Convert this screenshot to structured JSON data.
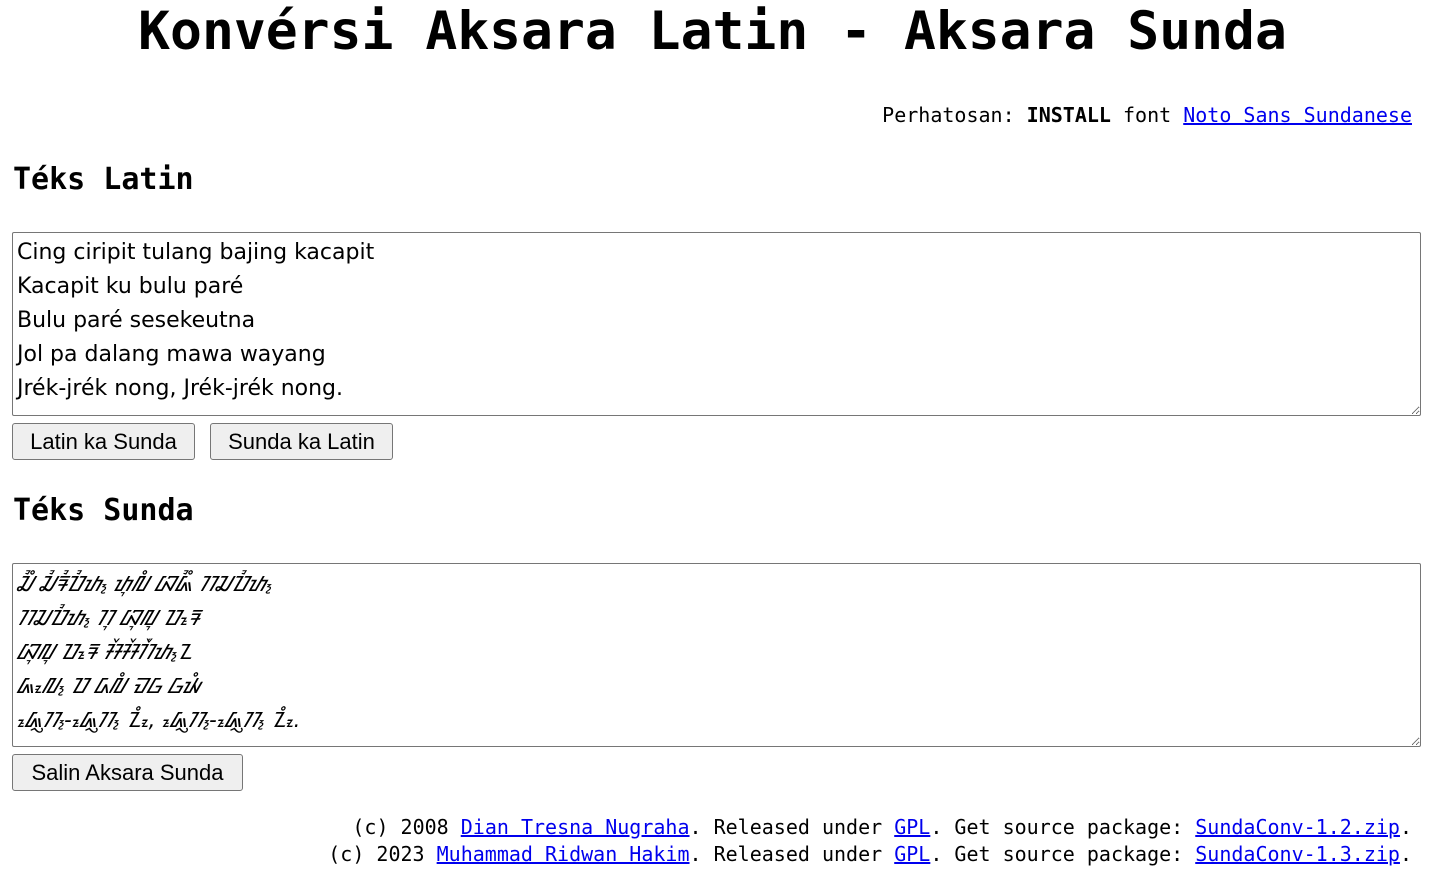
{
  "title": "Konvérsi Aksara Latin - Aksara Sunda",
  "notice": {
    "prefix": "Perhatosan: ",
    "strong": "INSTALL",
    "middle": " font ",
    "link": "Noto Sans Sundanese"
  },
  "latin_section": {
    "heading": "Téks Latin",
    "text": "Cing ciripit tulang bajing kacapit\nKacapit ku bulu paré\nBulu paré sesekeutna\nJol pa dalang mawa wayang\nJrék-jrék nong, Jrék-jrék nong."
  },
  "buttons": {
    "latin_to_sunda": "Latin ka Sunda",
    "sunda_to_latin": "Sunda ka Latin",
    "copy_sunda": "Salin Aksara Sunda"
  },
  "sunda_section": {
    "heading": "Téks Sunda",
    "text": "ᮎᮤᮀ ᮎᮤᮛᮤᮕᮤᮒ᮪ ᮒᮥᮜᮀ ᮘᮏᮤᮀ ᮊᮎᮕᮤᮒ᮪\nᮊᮎᮕᮤᮒ᮪ ᮊᮥ ᮘᮥᮜᮥ ᮕᮛᮦ\nᮘᮥᮜᮥ ᮕᮛᮦ ᮞᮨᮞᮨᮊᮩᮒ᮪ᮔ\nᮏᮧᮜ᮪ ᮕ ᮓᮜᮀ ᮙᮝ ᮝᮚᮀ\nᮏᮢᮦᮊ᮪-ᮏᮢᮦᮊ᮪ ᮔᮧᮀ, ᮏᮢᮦᮊ᮪-ᮏᮢᮦᮊ᮪ ᮔᮧᮀ."
  },
  "footer": [
    {
      "prefix": "(c) 2008 ",
      "author": "Dian Tresna Nugraha",
      "released": ". Released under ",
      "license": "GPL",
      "get": ". Get source package: ",
      "package": "SundaConv-1.2.zip",
      "end": "."
    },
    {
      "prefix": "(c) 2023 ",
      "author": "Muhammad Ridwan Hakim",
      "released": ". Released under ",
      "license": "GPL",
      "get": ". Get source package: ",
      "package": "SundaConv-1.3.zip",
      "end": "."
    }
  ],
  "colors": {
    "link": "#0000ee",
    "button_bg": "#efefef",
    "border": "#767676"
  }
}
